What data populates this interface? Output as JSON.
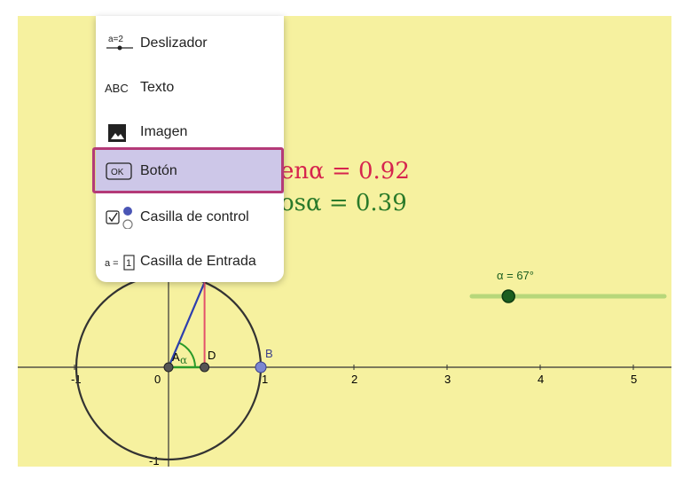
{
  "menu": {
    "items": [
      {
        "label": "Deslizador",
        "icon": "slider-icon",
        "icon_text": "a=2"
      },
      {
        "label": "Texto",
        "icon": "text-icon",
        "icon_text": "ABC"
      },
      {
        "label": "Imagen",
        "icon": "image-icon"
      },
      {
        "label": "Botón",
        "icon": "button-icon",
        "icon_text": "OK",
        "selected": true
      },
      {
        "label": "Casilla de control",
        "icon": "checkbox-icon"
      },
      {
        "label": "Casilla de Entrada",
        "icon": "input-box-icon",
        "icon_text": "a =",
        "icon_box_text": "1"
      }
    ]
  },
  "formulas": {
    "sen": "enα = 0.92",
    "cos": "osα = 0.39"
  },
  "slider": {
    "label": "α = 67°",
    "value_fraction": 0.19
  },
  "graph": {
    "x_ticks": [
      "-1",
      "0",
      "1",
      "2",
      "3",
      "4",
      "5"
    ],
    "y_ticks": [
      "-1"
    ],
    "points": {
      "A": "A",
      "B": "B",
      "D": "D"
    },
    "angle_label": "α"
  },
  "colors": {
    "background": "#f6f19f",
    "sen": "#d6244e",
    "cos": "#2a7a2a",
    "slider": "#1b5e20",
    "selection": "#cdc7e8",
    "highlight": "#b43a78"
  }
}
